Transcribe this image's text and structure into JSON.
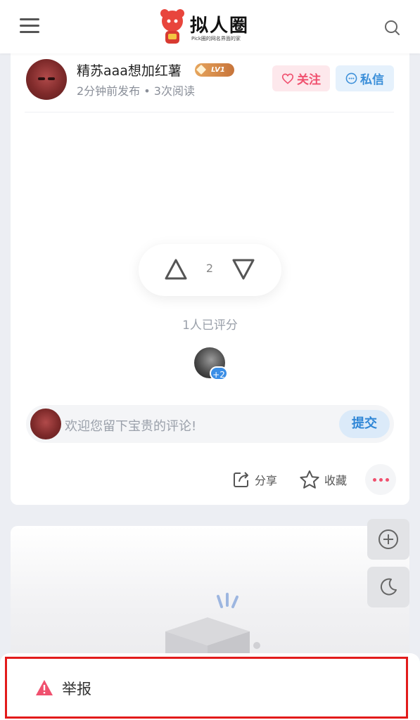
{
  "header": {
    "logo_title": "拟人圈",
    "logo_subtitle": "Pick圈的网名界面的家"
  },
  "post": {
    "author_name": "精苏aaa想加红薯",
    "level": "LV1",
    "meta": "2分钟前发布 • 3次阅读",
    "follow_label": "关注",
    "message_label": "私信",
    "vote_count": "2",
    "rated_text": "1人已评分",
    "rater_extra": "+2",
    "comment_placeholder": "欢迎您留下宝贵的评论!",
    "submit_label": "提交",
    "share_label": "分享",
    "collect_label": "收藏"
  },
  "report": {
    "label": "举报"
  },
  "colors": {
    "accent_pink": "#f0506e",
    "accent_blue": "#3b8fd9",
    "report_red": "#e21b1b"
  }
}
